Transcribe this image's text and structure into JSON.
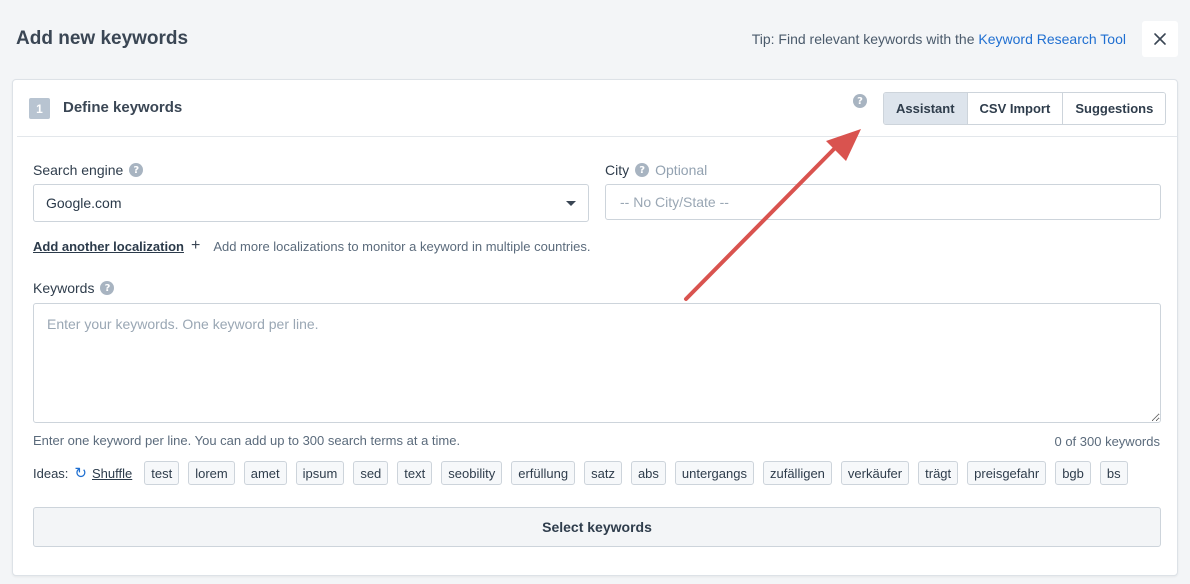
{
  "header": {
    "title": "Add new keywords",
    "tip_prefix": "Tip: Find relevant keywords with the",
    "tip_link": "Keyword Research Tool"
  },
  "step": {
    "number": "1",
    "title": "Define keywords"
  },
  "mode_tabs": [
    {
      "label": "Assistant",
      "active": true
    },
    {
      "label": "CSV Import",
      "active": false
    },
    {
      "label": "Suggestions",
      "active": false
    }
  ],
  "search_engine": {
    "label": "Search engine",
    "value": "Google.com"
  },
  "city": {
    "label": "City",
    "optional": "Optional",
    "placeholder": "-- No City/State --"
  },
  "localization": {
    "link": "Add another localization",
    "hint": "Add more localizations to monitor a keyword in multiple countries."
  },
  "keywords": {
    "label": "Keywords",
    "placeholder": "Enter your keywords. One keyword per line.",
    "hint": "Enter one keyword per line. You can add up to 300 search terms at a time.",
    "count": "0 of 300 keywords"
  },
  "ideas": {
    "label": "Ideas:",
    "shuffle": "Shuffle",
    "chips": [
      "test",
      "lorem",
      "amet",
      "ipsum",
      "sed",
      "text",
      "seobility",
      "erfüllung",
      "satz",
      "abs",
      "untergangs",
      "zufälligen",
      "verkäufer",
      "trägt",
      "preisgefahr",
      "bgb",
      "bs"
    ]
  },
  "select_button": "Select keywords",
  "colors": {
    "accent_link": "#1f6fd1",
    "annotation_arrow": "#d9534f",
    "active_tab": "#dde4ec"
  }
}
